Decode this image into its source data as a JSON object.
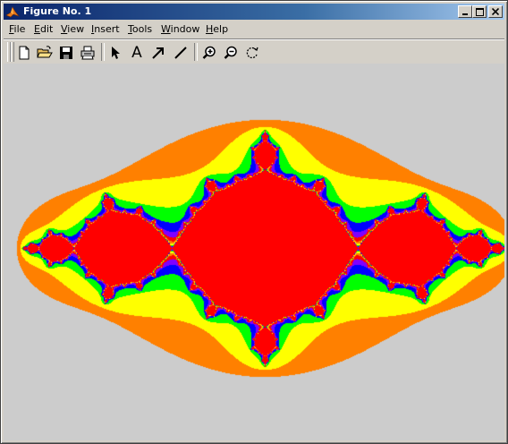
{
  "window": {
    "title": "Figure No. 1"
  },
  "menu": {
    "items": [
      {
        "id": "file",
        "label": "File",
        "key": "F",
        "rest": "ile"
      },
      {
        "id": "edit",
        "label": "Edit",
        "key": "E",
        "rest": "dit"
      },
      {
        "id": "view",
        "label": "View",
        "key": "V",
        "rest": "iew"
      },
      {
        "id": "insert",
        "label": "Insert",
        "key": "I",
        "rest": "nsert"
      },
      {
        "id": "tools",
        "label": "Tools",
        "key": "T",
        "rest": "ools"
      },
      {
        "id": "window",
        "label": "Window",
        "key": "W",
        "rest": "indow"
      },
      {
        "id": "help",
        "label": "Help",
        "key": "H",
        "rest": "elp"
      }
    ]
  },
  "toolbar": {
    "tools": [
      {
        "id": "new-figure",
        "icon": "new-document-icon"
      },
      {
        "id": "open-file",
        "icon": "open-folder-icon"
      },
      {
        "id": "save-figure",
        "icon": "save-disk-icon"
      },
      {
        "id": "print-figure",
        "icon": "printer-icon"
      },
      {
        "id": "edit-plot",
        "icon": "pointer-arrow-icon"
      },
      {
        "id": "insert-text",
        "icon": "text-a-icon",
        "glyph": "A"
      },
      {
        "id": "insert-arrow",
        "icon": "arrow-icon"
      },
      {
        "id": "insert-line",
        "icon": "line-icon"
      },
      {
        "id": "zoom-in",
        "icon": "zoom-in-icon"
      },
      {
        "id": "zoom-out",
        "icon": "zoom-out-icon"
      },
      {
        "id": "rotate-3d",
        "icon": "rotate-icon"
      }
    ]
  },
  "figure": {
    "background": "#cccccc",
    "content": "julia-fractal",
    "palette": [
      "#ff0000",
      "#ff8000",
      "#ffff00",
      "#00ff00",
      "#0000ff",
      "#8000ff"
    ]
  },
  "colors": {
    "titlebar_start": "#0a246a",
    "titlebar_end": "#a6caf0",
    "chrome": "#d4d0c8"
  }
}
